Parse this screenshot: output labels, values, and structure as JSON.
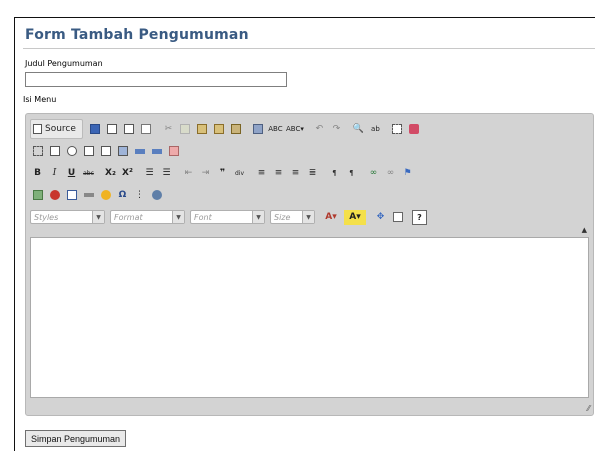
{
  "form": {
    "title": "Form Tambah Pengumuman",
    "judul_label": "Judul Pengumuman",
    "judul_value": "",
    "isi_label": "Isi Menu",
    "submit_label": "Simpan Pengumuman"
  },
  "editor": {
    "source_label": "Source",
    "combos": {
      "styles": "Styles",
      "format": "Format",
      "font": "Font",
      "size": "Size"
    },
    "toolbar_icons": [
      "source-icon",
      "save-icon",
      "new-page-icon",
      "preview-icon",
      "templates-icon",
      "cut-icon",
      "copy-icon",
      "paste-icon",
      "paste-text-icon",
      "paste-word-icon",
      "print-icon",
      "spellcheck-icon",
      "scayt-icon",
      "undo-icon",
      "redo-icon",
      "find-icon",
      "replace-icon",
      "select-all-icon",
      "remove-format-icon",
      "form-icon",
      "checkbox-icon",
      "radio-icon",
      "textfield-icon",
      "textarea-icon",
      "select-icon",
      "button-icon",
      "image-button-icon",
      "hidden-field-icon",
      "bold-icon",
      "italic-icon",
      "underline-icon",
      "strike-icon",
      "subscript-icon",
      "superscript-icon",
      "numbered-list-icon",
      "bulleted-list-icon",
      "outdent-icon",
      "indent-icon",
      "blockquote-icon",
      "creatediv-icon",
      "align-left-icon",
      "align-center-icon",
      "align-right-icon",
      "justify-icon",
      "ltr-icon",
      "rtl-icon",
      "link-icon",
      "unlink-icon",
      "anchor-icon",
      "image-icon",
      "flash-icon",
      "table-icon",
      "horizontal-rule-icon",
      "smiley-icon",
      "special-char-icon",
      "page-break-icon",
      "iframe-icon",
      "text-color-icon",
      "bg-color-icon",
      "maximize-icon",
      "show-blocks-icon",
      "about-icon"
    ]
  }
}
